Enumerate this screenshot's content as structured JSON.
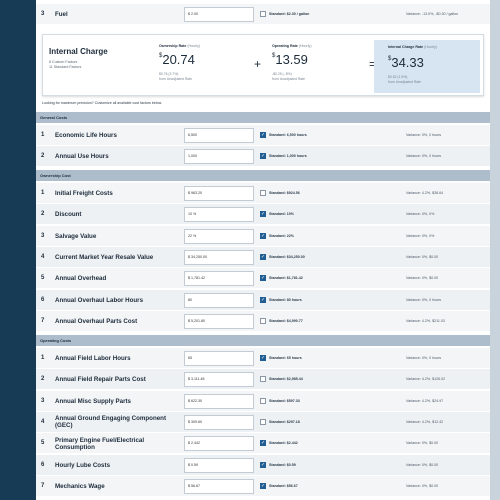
{
  "top_row": {
    "num": "3",
    "label": "Fuel",
    "input": "$ 2.00",
    "checked": false,
    "standard": "Standard: $2.30 / gallon",
    "variance": "Variance: -13.0%, -$0.30 / gallon"
  },
  "summary": {
    "title": "Internal Charge",
    "custom_factors": "8 Custom Factors",
    "standard_factors": "11 Standard Factors",
    "ownership": {
      "label": "Ownership Rate",
      "unit": "(Hourly)",
      "currency": "$",
      "value": "20.74",
      "delta": "$0.76 (3.7%)",
      "from": "from Unadjusted Rate"
    },
    "plus": "+",
    "operating": {
      "label": "Operating Rate",
      "unit": "(Hourly)",
      "currency": "$",
      "value": "13.59",
      "delta": "-$0.25 (-.8%)",
      "from": "from Unadjusted Rate"
    },
    "equals": "=",
    "internal": {
      "label": "Internal Charge Rate",
      "unit": "(Hourly)",
      "currency": "$",
      "value": "34.33",
      "delta": "$0.52 (1.5%)",
      "from": "from Unadjusted Rate"
    }
  },
  "hint": "Looking for maximum precision? Customize all available cost factors below.",
  "sections": [
    {
      "title": "General Costs",
      "rows": [
        {
          "num": "1",
          "label": "Economic Life Hours",
          "input": "6,500",
          "checked": true,
          "standard": "Standard: 6,500 hours",
          "variance": "Variance: 0%, 0 hours"
        },
        {
          "num": "2",
          "label": "Annual Use Hours",
          "input": "1,000",
          "checked": true,
          "standard": "Standard: 1,000 hours",
          "variance": "Variance: 0%, 0 hours"
        }
      ]
    },
    {
      "title": "Ownership Cost",
      "rows": [
        {
          "num": "1",
          "label": "Initial Freight Costs",
          "input": "$ 963.20",
          "checked": false,
          "standard": "Standard: $924.56",
          "variance": "Variance: 4.2%, $38.64"
        },
        {
          "num": "2",
          "label": "Discount",
          "input": "10 %",
          "checked": true,
          "standard": "Standard: 10%",
          "variance": "Variance: 0%, 0%"
        },
        {
          "num": "3",
          "label": "Salvage Value",
          "input": "22 %",
          "checked": true,
          "standard": "Standard: 22%",
          "variance": "Variance: 0%, 0%"
        },
        {
          "num": "4",
          "label": "Current Market Year Resale Value",
          "input": "$ 34,250.00",
          "checked": true,
          "standard": "Standard: $34,250.00",
          "variance": "Variance: 0%, $0.00"
        },
        {
          "num": "5",
          "label": "Annual Overhead",
          "input": "$ 1,781.42",
          "checked": true,
          "standard": "Standard: $1,781.42",
          "variance": "Variance: 0%, $0.00"
        },
        {
          "num": "6",
          "label": "Annual Overhaul Labor Hours",
          "input": "80",
          "checked": true,
          "standard": "Standard: 80 hours",
          "variance": "Variance: 0%, 0 hours"
        },
        {
          "num": "7",
          "label": "Annual Overhaul Parts Cost",
          "input": "$ 5,201.80",
          "checked": false,
          "standard": "Standard: $4,990.77",
          "variance": "Variance: 4.2%, $211.03"
        }
      ]
    },
    {
      "title": "Operating Costs",
      "rows": [
        {
          "num": "1",
          "label": "Annual Field Labor Hours",
          "input": "65",
          "checked": true,
          "standard": "Standard: 65 hours",
          "variance": "Variance: 0%, 0 hours"
        },
        {
          "num": "2",
          "label": "Annual Field Repair Parts Cost",
          "input": "$ 3,111.46",
          "checked": false,
          "standard": "Standard: $2,985.44",
          "variance": "Variance: 4.2%, $126.02"
        },
        {
          "num": "3",
          "label": "Annual Misc Supply Parts",
          "input": "$ 622.30",
          "checked": false,
          "standard": "Standard: $597.33",
          "variance": "Variance: 4.2%, $24.97"
        },
        {
          "num": "4",
          "label": "Annual Ground Engaging Component (GEC)",
          "input": "$ 309.60",
          "checked": false,
          "standard": "Standard: $297.18",
          "variance": "Variance: 4.2%, $12.42"
        },
        {
          "num": "5",
          "label": "Primary Engine Fuel/Electrical Consumption",
          "input": "$ 2.442",
          "checked": true,
          "standard": "Standard: $2.442",
          "variance": "Variance: 0%, $0.00"
        },
        {
          "num": "6",
          "label": "Hourly Lube Costs",
          "input": "$ 0.59",
          "checked": true,
          "standard": "Standard: $0.59",
          "variance": "Variance: 0%, $0.00"
        },
        {
          "num": "7",
          "label": "Mechanics Wage",
          "input": "$ 56.67",
          "checked": true,
          "standard": "Standard: $56.67",
          "variance": "Variance: 0%, $0.00"
        }
      ]
    }
  ],
  "colors": {
    "sidebar": "#173a55",
    "section_header": "#aebdcb",
    "result_box": "#d6e5f1",
    "checkbox_on": "#1f5d93"
  }
}
